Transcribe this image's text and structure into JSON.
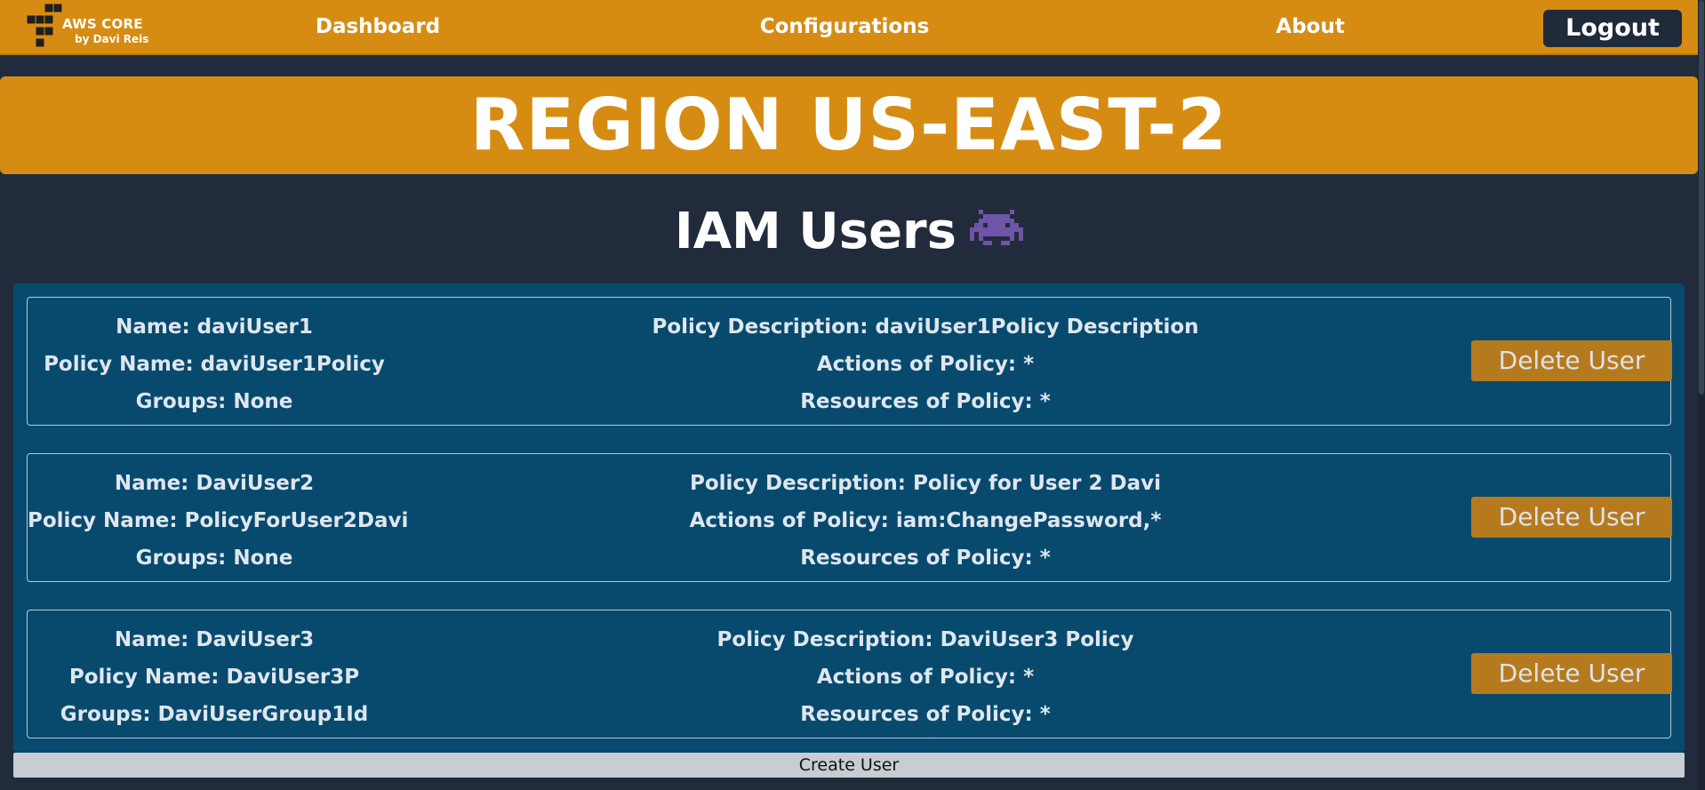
{
  "nav": {
    "logo_title": "AWS CORE",
    "logo_subtitle": "by Davi Reis",
    "links": [
      "Dashboard",
      "Configurations",
      "About"
    ],
    "logout_label": "Logout"
  },
  "region": {
    "title": "REGION US-EAST-2"
  },
  "section": {
    "title": "IAM Users",
    "icon": "alien-monster-icon"
  },
  "users": [
    {
      "name": "Name: daviUser1",
      "policy_name": "Policy Name: daviUser1Policy",
      "groups": "Groups: None",
      "policy_description": "Policy Description: daviUser1Policy Description",
      "actions": "Actions of Policy: *",
      "resources": "Resources of Policy: *",
      "delete_label": "Delete User"
    },
    {
      "name": "Name: DaviUser2",
      "policy_name": "Policy Name: PolicyForUser2Davi",
      "groups": "Groups: None",
      "policy_description": "Policy Description: Policy for User 2 Davi",
      "actions": "Actions of Policy: iam:ChangePassword,*",
      "resources": "Resources of Policy: *",
      "delete_label": "Delete User"
    },
    {
      "name": "Name: DaviUser3",
      "policy_name": "Policy Name: DaviUser3P",
      "groups": "Groups: DaviUserGroup1Id",
      "policy_description": "Policy Description: DaviUser3 Policy",
      "actions": "Actions of Policy: *",
      "resources": "Resources of Policy: *",
      "delete_label": "Delete User"
    }
  ],
  "create_label": "Create User",
  "colors": {
    "accent": "#d68c13",
    "background": "#222b3c",
    "panel": "#074a6e",
    "delete_button": "#b67a1e",
    "logout_button": "#1f2a3a"
  }
}
